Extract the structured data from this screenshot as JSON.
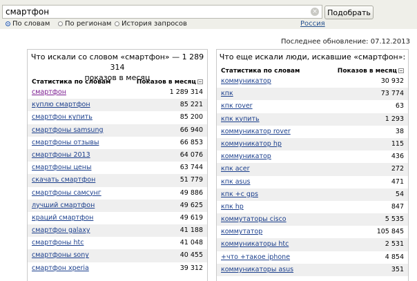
{
  "search": {
    "query": "смартфон",
    "submit_label": "Подобрать",
    "clear_symbol": "×"
  },
  "modes": [
    {
      "label": "По словам",
      "selected": true
    },
    {
      "label": "По регионам",
      "selected": false
    },
    {
      "label": "История запросов",
      "selected": false
    }
  ],
  "region_link": "Россия",
  "last_update": "Последнее обновление: 07.12.2013",
  "left_panel": {
    "title_line1": "Что искали со словом «смартфон» — 1 289 314",
    "title_line2": "показов в месяц",
    "col_keywords": "Статистика по словам",
    "col_impressions": "Показов в месяц",
    "rows": [
      {
        "keyword": "смартфон",
        "count": "1 289 314"
      },
      {
        "keyword": "куплю смартфон",
        "count": "85 221"
      },
      {
        "keyword": "смартфон купить",
        "count": "85 200"
      },
      {
        "keyword": "смартфоны samsung",
        "count": "66 940"
      },
      {
        "keyword": "смартфоны отзывы",
        "count": "66 853"
      },
      {
        "keyword": "смартфоны 2013",
        "count": "64 076"
      },
      {
        "keyword": "смартфоны цены",
        "count": "63 744"
      },
      {
        "keyword": "скачать смартфон",
        "count": "51 779"
      },
      {
        "keyword": "смартфоны самсунг",
        "count": "49 886"
      },
      {
        "keyword": "лучший смартфон",
        "count": "49 625"
      },
      {
        "keyword": "краций смартфон",
        "count": "49 619"
      },
      {
        "keyword": "смартфон galaxy",
        "count": "41 188"
      },
      {
        "keyword": "смартфоны htc",
        "count": "41 048"
      },
      {
        "keyword": "смартфоны sony",
        "count": "40 455"
      },
      {
        "keyword": "смартфон xperia",
        "count": "39 312"
      }
    ]
  },
  "right_panel": {
    "title": "Что еще искали люди, искавшие «смартфон»:",
    "col_keywords": "Статистика по словам",
    "col_impressions": "Показов в месяц",
    "rows": [
      {
        "keyword": "коммуникатор",
        "count": "30 932"
      },
      {
        "keyword": "кпк",
        "count": "73 774"
      },
      {
        "keyword": "кпк rover",
        "count": "63"
      },
      {
        "keyword": "кпк купить",
        "count": "1 293"
      },
      {
        "keyword": "коммуникатор rover",
        "count": "38"
      },
      {
        "keyword": "коммуникатор hp",
        "count": "115"
      },
      {
        "keyword": "коммуникатор",
        "count": "436"
      },
      {
        "keyword": "кпк acer",
        "count": "272"
      },
      {
        "keyword": "кпк asus",
        "count": "471"
      },
      {
        "keyword": "кпк +с gps",
        "count": "54"
      },
      {
        "keyword": "кпк hp",
        "count": "847"
      },
      {
        "keyword": "коммутаторы cisco",
        "count": "5 535"
      },
      {
        "keyword": "коммутатор",
        "count": "105 845"
      },
      {
        "keyword": "коммуникаторы htc",
        "count": "2 531"
      },
      {
        "keyword": "+что +такое iphone",
        "count": "4 854"
      },
      {
        "keyword": "коммуникаторы asus",
        "count": "351"
      }
    ]
  }
}
